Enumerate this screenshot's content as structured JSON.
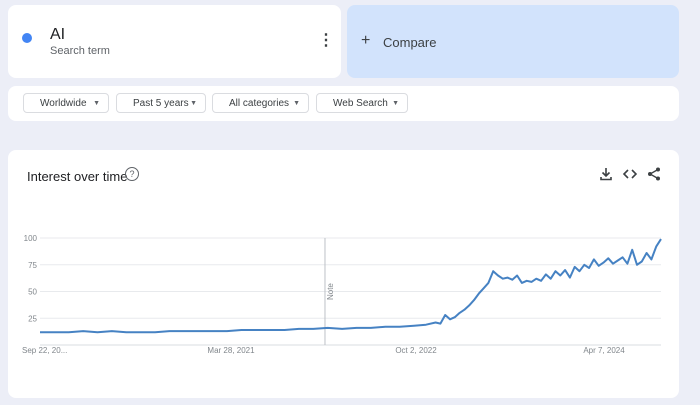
{
  "search_term": {
    "name": "AI",
    "subtitle": "Search term",
    "color": "#4285f4"
  },
  "compare": {
    "label": "Compare"
  },
  "filters": {
    "region": "Worldwide",
    "time_range": "Past 5 years",
    "category": "All categories",
    "search_type": "Web Search"
  },
  "chart": {
    "title": "Interest over time",
    "note_label": "Note",
    "icons": [
      "help-icon",
      "download-icon",
      "embed-icon",
      "share-icon"
    ]
  },
  "chart_data": {
    "type": "line",
    "title": "Interest over time",
    "xlabel": "",
    "ylabel": "",
    "ylim": [
      0,
      100
    ],
    "yticks": [
      25,
      50,
      75,
      100
    ],
    "xtick_labels": [
      "Sep 22, 20...",
      "Mar 28, 2021",
      "Oct 2, 2022",
      "Apr 7, 2024"
    ],
    "grid": true,
    "series": [
      {
        "color": "#4682c3",
        "x": [
          "2019-09-22",
          "2019-11-03",
          "2019-12-15",
          "2020-01-26",
          "2020-03-08",
          "2020-04-19",
          "2020-05-31",
          "2020-07-12",
          "2020-08-23",
          "2020-10-04",
          "2020-11-15",
          "2020-12-27",
          "2021-02-07",
          "2021-03-21",
          "2021-05-02",
          "2021-06-13",
          "2021-07-25",
          "2021-09-05",
          "2021-10-17",
          "2021-11-28",
          "2022-01-09",
          "2022-02-20",
          "2022-04-03",
          "2022-05-15",
          "2022-06-26",
          "2022-08-07",
          "2022-09-18",
          "2022-10-23",
          "2022-11-20",
          "2022-12-04",
          "2022-12-18",
          "2023-01-01",
          "2023-01-15",
          "2023-01-29",
          "2023-02-12",
          "2023-02-26",
          "2023-03-12",
          "2023-03-26",
          "2023-04-09",
          "2023-04-23",
          "2023-05-07",
          "2023-05-21",
          "2023-06-04",
          "2023-06-18",
          "2023-07-02",
          "2023-07-16",
          "2023-07-30",
          "2023-08-13",
          "2023-08-27",
          "2023-09-10",
          "2023-09-24",
          "2023-10-08",
          "2023-10-22",
          "2023-11-05",
          "2023-11-19",
          "2023-12-03",
          "2023-12-17",
          "2023-12-31",
          "2024-01-14",
          "2024-01-28",
          "2024-02-11",
          "2024-02-25",
          "2024-03-10",
          "2024-03-24",
          "2024-04-07",
          "2024-04-21",
          "2024-05-05",
          "2024-05-19",
          "2024-06-02",
          "2024-06-16",
          "2024-06-30",
          "2024-07-14",
          "2024-07-28",
          "2024-08-11",
          "2024-08-25",
          "2024-09-08"
        ],
        "values": [
          12,
          12,
          12,
          13,
          12,
          13,
          12,
          12,
          12,
          13,
          13,
          13,
          13,
          13,
          14,
          14,
          14,
          14,
          15,
          15,
          16,
          15,
          16,
          16,
          17,
          17,
          18,
          19,
          21,
          20,
          28,
          24,
          26,
          30,
          33,
          37,
          42,
          48,
          53,
          58,
          69,
          65,
          62,
          63,
          61,
          65,
          58,
          60,
          59,
          62,
          60,
          66,
          62,
          69,
          65,
          70,
          63,
          73,
          69,
          75,
          72,
          80,
          74,
          77,
          81,
          76,
          79,
          82,
          76,
          89,
          75,
          78,
          86,
          80,
          92,
          99
        ]
      }
    ]
  }
}
